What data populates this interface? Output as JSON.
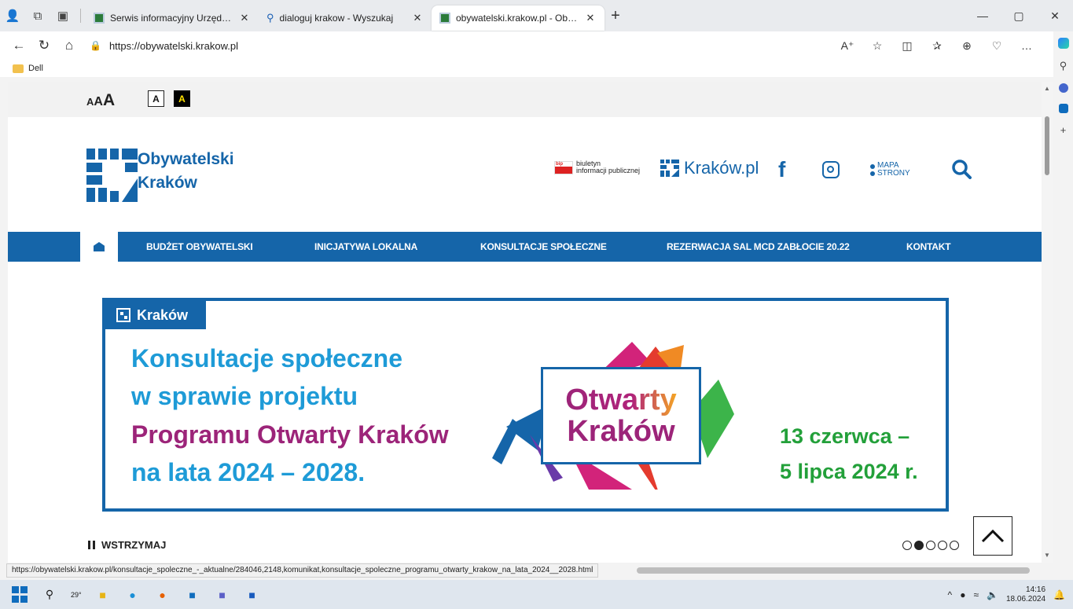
{
  "browser": {
    "tabs": [
      {
        "title": "Serwis informacyjny Urzędu Mias",
        "active": false
      },
      {
        "title": "dialoguj krakow - Wyszukaj",
        "active": false
      },
      {
        "title": "obywatelski.krakow.pl - Obywate",
        "active": true
      }
    ],
    "url": "https://obywatelski.krakow.pl",
    "favorites": [
      {
        "label": "Dell"
      }
    ],
    "status_url": "https://obywatelski.krakow.pl/konsultacje_spoleczne_-_aktualne/284046,2148,komunikat,konsultacje_spoleczne_programu_otwarty_krakow_na_lata_2024__2028.html"
  },
  "site": {
    "font_size_labels": [
      "A",
      "A",
      "A"
    ],
    "contrast_labels": [
      "A",
      "A"
    ],
    "logo": {
      "line1": "Obywatelski",
      "line2": "Kraków"
    },
    "bip": {
      "badge": "bip",
      "line1": "biuletyn",
      "line2": "informacji publicznej"
    },
    "krakow_pl": "Kraków.pl",
    "facebook_glyph": "f",
    "sitemap": {
      "line1": "MAPA",
      "line2": "STRONY"
    },
    "nav": [
      {
        "label": "BUDŻET OBYWATELSKI"
      },
      {
        "label": "INICJATYWA LOKALNA"
      },
      {
        "label": "KONSULTACJE SPOŁECZNE"
      },
      {
        "label": "REZERWACJA SAL MCD ZABŁOCIE 20.22"
      },
      {
        "label": "KONTAKT"
      }
    ],
    "banner": {
      "tag": "Kraków",
      "lines": [
        "Konsultacje społeczne",
        "w sprawie projektu",
        "Programu Otwarty Kraków",
        "na lata 2024 – 2028."
      ],
      "logo_line1": "Otwarty",
      "logo_line2": "Kraków",
      "date_line1": "13 czerwca –",
      "date_line2": "5 lipca 2024 r."
    },
    "pause_label": "WSTRZYMAJ",
    "slider": {
      "count": 5,
      "active_index": 1
    }
  },
  "taskbar": {
    "weather": "29°",
    "time": "14:16",
    "date": "18.06.2024"
  },
  "colors": {
    "brand_blue": "#1565a9",
    "banner_cyan": "#1e9bd7",
    "banner_magenta": "#9c2479",
    "date_green": "#23a03a"
  }
}
